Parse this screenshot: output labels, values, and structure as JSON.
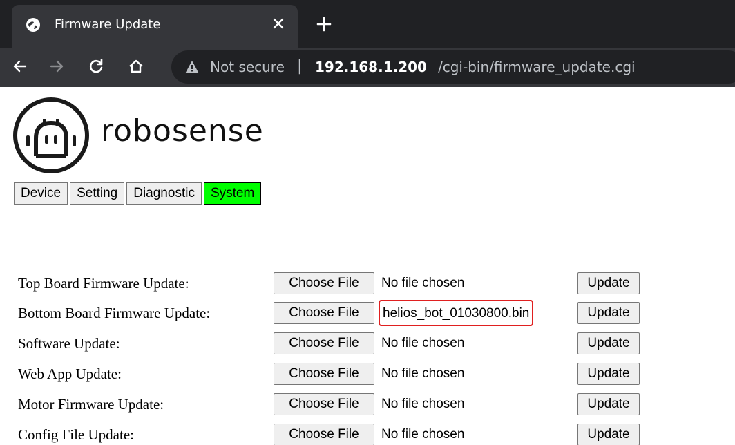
{
  "browser": {
    "tab_title": "Firmware Update",
    "security_label": "Not secure",
    "separator": "|",
    "url_host": "192.168.1.200",
    "url_path": "/cgi-bin/firmware_update.cgi",
    "icons": [
      "globe-icon",
      "close-icon",
      "plus-icon",
      "back-arrow-icon",
      "forward-arrow-icon",
      "reload-icon",
      "home-icon",
      "warning-icon"
    ]
  },
  "brand": {
    "name": "robosense"
  },
  "menu": {
    "items": [
      {
        "label": "Device",
        "active": false
      },
      {
        "label": "Setting",
        "active": false
      },
      {
        "label": "Diagnostic",
        "active": false
      },
      {
        "label": "System",
        "active": true
      }
    ],
    "active_color": "#00ff00"
  },
  "form": {
    "choose_label": "Choose File",
    "update_label": "Update",
    "highlight_color": "#e02020",
    "rows": [
      {
        "label": "Top Board Firmware Update:",
        "file": "No file chosen",
        "highlighted": false
      },
      {
        "label": "Bottom Board Firmware Update:",
        "file": "helios_bot_01030800.bin",
        "highlighted": true
      },
      {
        "label": "Software Update:",
        "file": "No file chosen",
        "highlighted": false
      },
      {
        "label": "Web App Update:",
        "file": "No file chosen",
        "highlighted": false
      },
      {
        "label": "Motor Firmware Update:",
        "file": "No file chosen",
        "highlighted": false
      },
      {
        "label": "Config File Update:",
        "file": "No file chosen",
        "highlighted": false
      }
    ]
  }
}
